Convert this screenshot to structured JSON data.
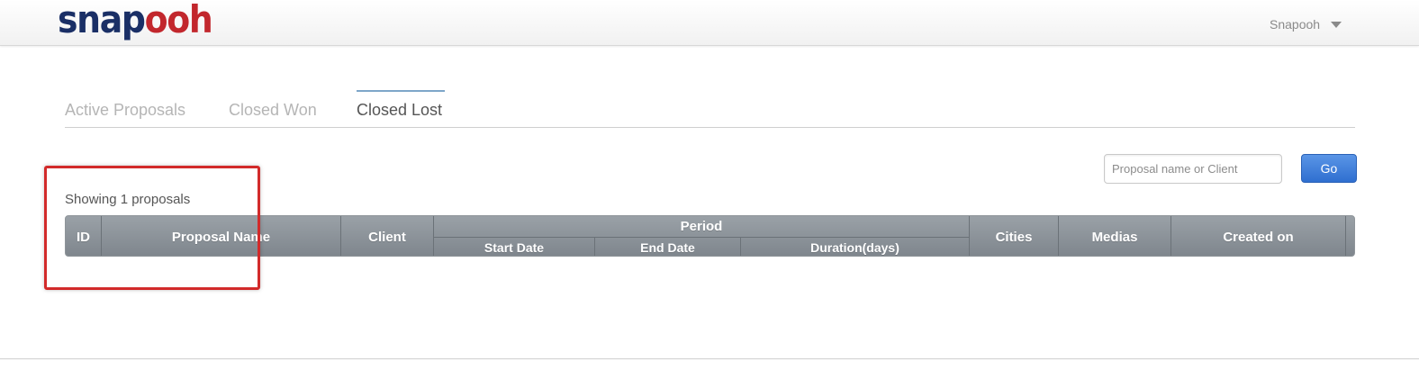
{
  "header": {
    "logo_part1": "snap",
    "logo_part2": "ooh",
    "user_name": "Snapooh"
  },
  "tabs": [
    {
      "label": "Active Proposals",
      "active": false
    },
    {
      "label": "Closed Won",
      "active": false
    },
    {
      "label": "Closed Lost",
      "active": true
    }
  ],
  "search": {
    "placeholder": "Proposal name or Client",
    "button_label": "Go"
  },
  "summary": {
    "showing_text": "Showing 1 proposals"
  },
  "table": {
    "columns": {
      "id": "ID",
      "proposal_name": "Proposal Name",
      "client": "Client",
      "period": "Period",
      "start_date": "Start Date",
      "end_date": "End Date",
      "duration": "Duration(days)",
      "cities": "Cities",
      "medias": "Medias",
      "created_on": "Created on"
    },
    "rows": []
  },
  "colors": {
    "logo_blue": "#1a2f66",
    "logo_red": "#c2272d",
    "accent": "#2f6fd0",
    "highlight": "#d22a2a"
  }
}
